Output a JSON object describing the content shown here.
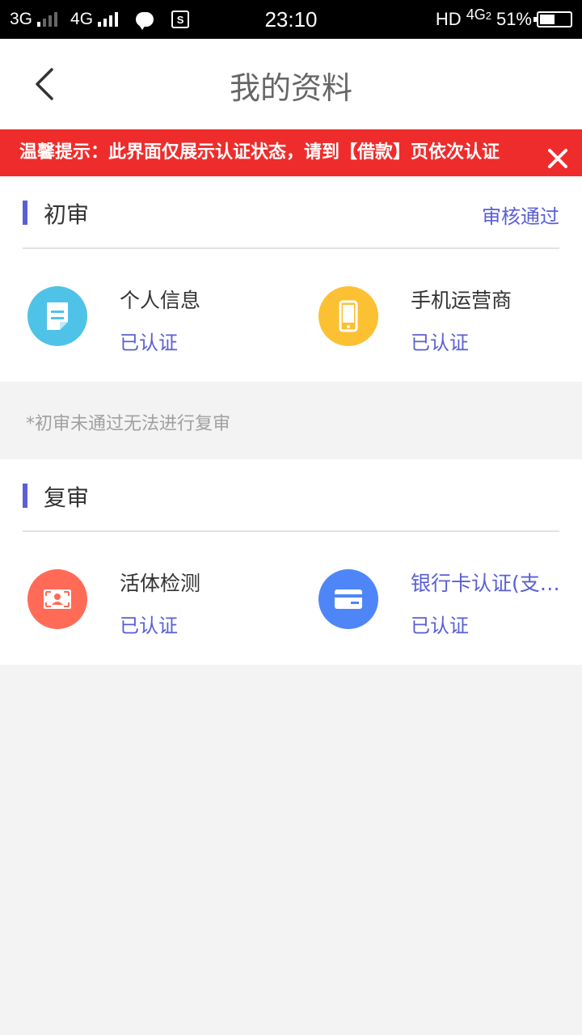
{
  "status_bar": {
    "net1": "3G",
    "net2": "4G",
    "time": "23:10",
    "hd": "HD",
    "net3": "4G",
    "net3_sub": "2",
    "battery": "51%",
    "battery_level": 0.51
  },
  "header": {
    "title": "我的资料",
    "back_icon": "chevron-left-icon"
  },
  "banner": {
    "text": "温馨提示：此界面仅展示认证状态，请到【借款】页依次认证",
    "close_icon": "close-icon",
    "color": "#ef2c2c"
  },
  "initial_review": {
    "title": "初审",
    "status": "审核通过",
    "items": [
      {
        "name": "个人信息",
        "state": "已认证",
        "icon": "document-icon",
        "color": "#4fc2e8"
      },
      {
        "name": "手机运营商",
        "state": "已认证",
        "icon": "phone-icon",
        "color": "#fcc033"
      }
    ]
  },
  "note": "*初审未通过无法进行复审",
  "second_review": {
    "title": "复审",
    "items": [
      {
        "name": "活体检测",
        "state": "已认证",
        "icon": "face-scan-icon",
        "color": "#ff6b57"
      },
      {
        "name": "银行卡认证(支付宝)",
        "state": "已认证",
        "icon": "bank-card-icon",
        "color": "#4e86f7"
      }
    ]
  },
  "accent_color": "#5a5fd6"
}
